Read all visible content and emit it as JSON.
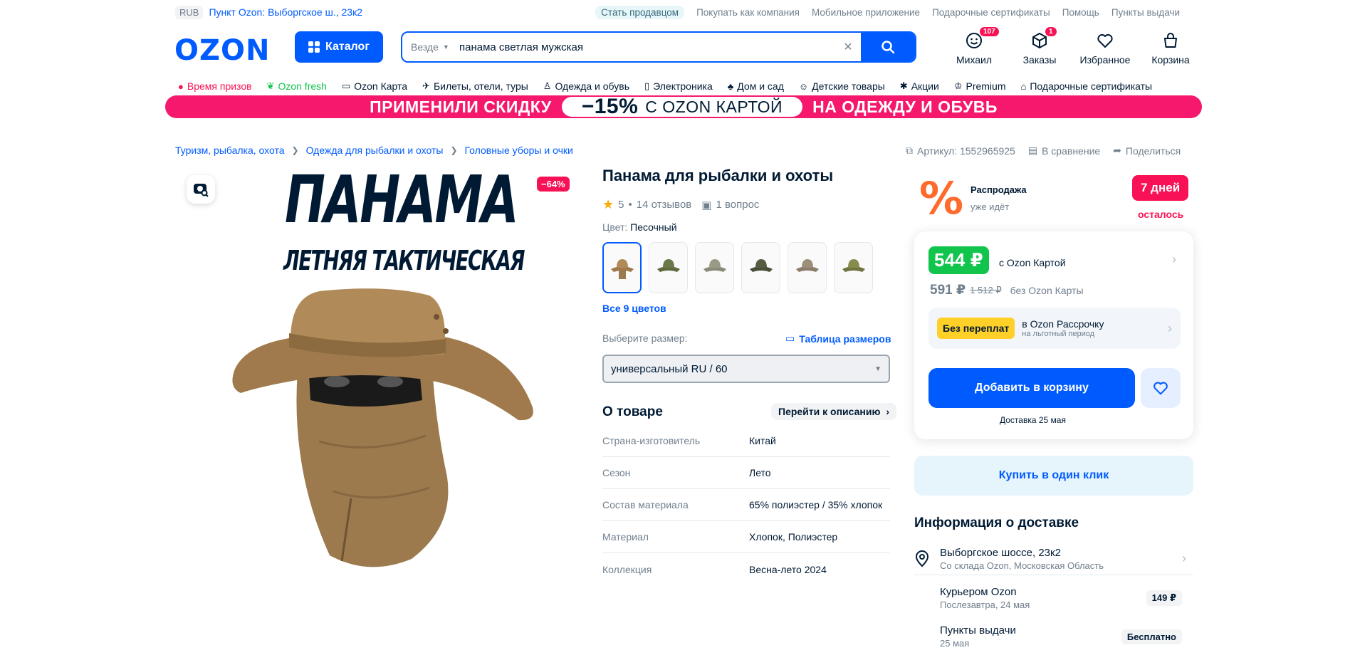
{
  "topbar": {
    "currency": "RUB",
    "pickup": "Пункт Ozon: Выборгское ш., 23к2",
    "links": [
      "Стать продавцом",
      "Покупать как компания",
      "Мобильное приложение",
      "Подарочные сертификаты",
      "Помощь",
      "Пункты выдачи"
    ]
  },
  "header": {
    "logo": "OZON",
    "catalog_label": "Каталог",
    "search_scope": "Везде",
    "search_value": "панама светлая мужская",
    "icons": [
      {
        "label": "Михаил",
        "badge": "107",
        "icon": "smile-icon"
      },
      {
        "label": "Заказы",
        "badge": "1",
        "icon": "box-icon"
      },
      {
        "label": "Избранное",
        "badge": "",
        "icon": "heart-icon"
      },
      {
        "label": "Корзина",
        "badge": "",
        "icon": "bag-icon"
      }
    ]
  },
  "nav": {
    "items": [
      {
        "label": "Время призов",
        "icon": "gift-circle-icon"
      },
      {
        "label": "Ozon fresh",
        "icon": "fresh-icon"
      },
      {
        "label": "Ozon Карта",
        "icon": "card-icon"
      },
      {
        "label": "Билеты, отели, туры",
        "icon": "plane-icon"
      },
      {
        "label": "Одежда и обувь",
        "icon": "clothes-icon"
      },
      {
        "label": "Электроника",
        "icon": "phone-icon"
      },
      {
        "label": "Дом и сад",
        "icon": "plant-icon"
      },
      {
        "label": "Детские товары",
        "icon": "baby-icon"
      },
      {
        "label": "Акции",
        "icon": "percent-icon"
      },
      {
        "label": "Premium",
        "icon": "crown-icon"
      },
      {
        "label": "Подарочные сертификаты",
        "icon": "gift-icon"
      }
    ]
  },
  "banner": {
    "left": "ПРИМЕНИЛИ СКИДКУ",
    "discount": "−15%",
    "card": "С OZON КАРТОЙ",
    "right": "НА ОДЕЖДУ И ОБУВЬ"
  },
  "breadcrumbs": [
    "Туризм, рыбалка, охота",
    "Одежда для рыбалки и охоты",
    "Головные уборы и очки"
  ],
  "meta": {
    "article": "Артикул: 1552965925",
    "compare": "В сравнение",
    "share": "Поделиться"
  },
  "image": {
    "discount_badge": "−64%",
    "print_title": "ПАНАМА",
    "print_subtitle": "ЛЕТНЯЯ ТАКТИЧЕСКАЯ"
  },
  "product": {
    "title": "Панама для рыбалки и охоты",
    "rating": "5",
    "reviews": "14 отзывов",
    "questions": "1 вопрос",
    "color_label": "Цвет:",
    "color_value": "Песочный",
    "all_colors": "Все 9 цветов",
    "size_label": "Выберите размер:",
    "size_table": "Таблица размеров",
    "size_value": "универсальный RU / 60",
    "about": "О товаре",
    "to_description": "Перейти к описанию",
    "specs": [
      {
        "k": "Страна-изготовитель",
        "v": "Китай"
      },
      {
        "k": "Сезон",
        "v": "Лето"
      },
      {
        "k": "Состав материала",
        "v": "65% полиэстер / 35% хлопок"
      },
      {
        "k": "Материал",
        "v": "Хлопок, Полиэстер"
      },
      {
        "k": "Коллекция",
        "v": "Весна-лето 2024"
      }
    ]
  },
  "sale": {
    "title": "Распродажа",
    "subtitle": "уже идёт",
    "days": "7 дней",
    "left": "осталось"
  },
  "price": {
    "card_price": "544 ₽",
    "card_label": "с Ozon Картой",
    "price": "591 ₽",
    "old_price": "1 512 ₽",
    "no_card_label": "без Ozon Карты",
    "installment_badge": "Без переплат",
    "installment_title": "в Ozon Рассрочку",
    "installment_sub": "на льготный период",
    "add_to_cart": "Добавить в корзину",
    "delivery_date": "Доставка 25 мая",
    "one_click": "Купить в один клик"
  },
  "delivery": {
    "title": "Информация о доставке",
    "address": "Выборгское шоссе, 23к2",
    "address_sub": "Со склада Ozon, Московская Область",
    "courier": "Курьером Ozon",
    "courier_sub": "Послезавтра, 24 мая",
    "courier_price": "149 ₽",
    "pickup": "Пункты выдачи",
    "pickup_sub": "25 мая",
    "pickup_price": "Бесплатно"
  },
  "colors": {
    "accent": "#005bff",
    "sale": "#f91155",
    "green": "#10c44c",
    "banner": "#f5186c",
    "hat": "#a07a4c"
  }
}
